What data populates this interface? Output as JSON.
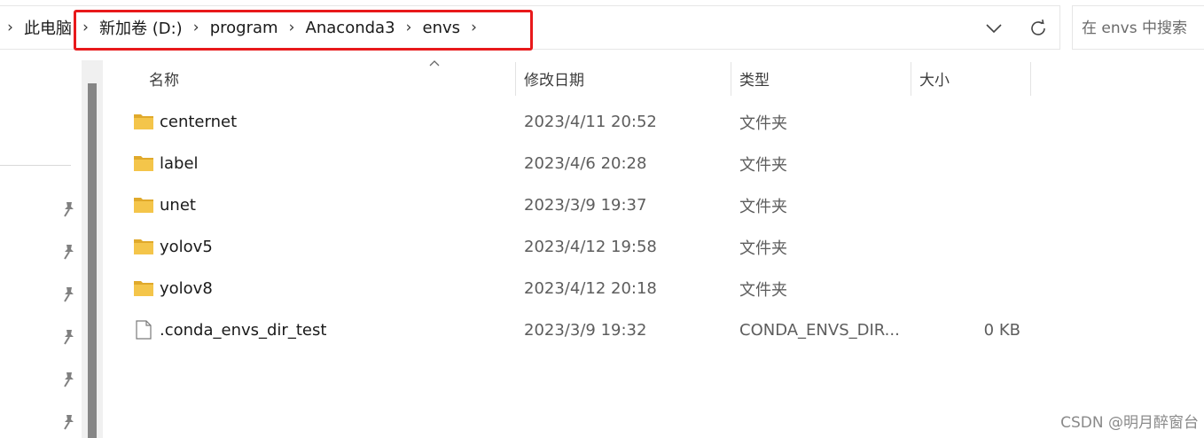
{
  "address_bar": {
    "breadcrumbs": [
      "此电脑",
      "新加卷 (D:)",
      "program",
      "Anaconda3",
      "envs"
    ],
    "dropdown_icon": "chevron-down-icon",
    "refresh_icon": "refresh-icon",
    "highlight_color": "#e8191b"
  },
  "search": {
    "placeholder": "在 envs 中搜索"
  },
  "columns": {
    "name": "名称",
    "date": "修改日期",
    "type": "类型",
    "size": "大小"
  },
  "files": [
    {
      "name": "centernet",
      "date": "2023/4/11 20:52",
      "type": "文件夹",
      "size": "",
      "icon": "folder-icon"
    },
    {
      "name": "label",
      "date": "2023/4/6 20:28",
      "type": "文件夹",
      "size": "",
      "icon": "folder-icon"
    },
    {
      "name": "unet",
      "date": "2023/3/9 19:37",
      "type": "文件夹",
      "size": "",
      "icon": "folder-icon"
    },
    {
      "name": "yolov5",
      "date": "2023/4/12 19:58",
      "type": "文件夹",
      "size": "",
      "icon": "folder-icon"
    },
    {
      "name": "yolov8",
      "date": "2023/4/12 20:18",
      "type": "文件夹",
      "size": "",
      "icon": "folder-icon"
    },
    {
      "name": ".conda_envs_dir_test",
      "date": "2023/3/9 19:32",
      "type": "CONDA_ENVS_DIR...",
      "size": "0 KB",
      "icon": "file-icon"
    }
  ],
  "colors": {
    "folder": "#f4c54a",
    "folder_dark": "#e0a92b"
  },
  "watermark": "CSDN @明月醉窗台"
}
